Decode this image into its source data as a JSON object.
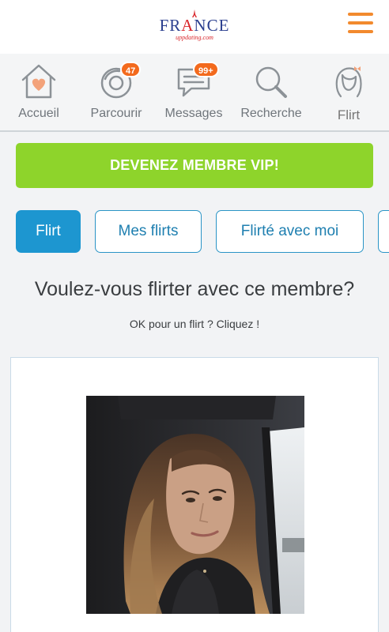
{
  "header": {
    "logo_text_before": "FR",
    "logo_text_accent": "A",
    "logo_text_after": "NCE",
    "logo_subtext": "uppdating.com",
    "menu_icon": "hamburger-icon",
    "accent_color": "#f28a2e"
  },
  "nav": {
    "items": [
      {
        "label": "Accueil",
        "icon": "home-heart-icon"
      },
      {
        "label": "Parcourir",
        "icon": "browse-icon",
        "badge": "47"
      },
      {
        "label": "Messages",
        "icon": "chat-icon",
        "badge": "99+"
      },
      {
        "label": "Recherche",
        "icon": "search-icon"
      },
      {
        "label": "Flirt",
        "icon": "flirt-icon"
      }
    ]
  },
  "vip_button": {
    "label": "DEVENEZ MEMBRE VIP!",
    "color": "#8ed42b"
  },
  "tabs": [
    {
      "label": "Flirt",
      "active": true
    },
    {
      "label": "Mes flirts",
      "active": false
    },
    {
      "label": "Flirté avec moi",
      "active": false
    }
  ],
  "flirt": {
    "question": "Voulez-vous flirter avec ce membre?",
    "subtitle": "OK pour un flirt ? Cliquez !"
  },
  "colors": {
    "primary_blue": "#1d96d0",
    "badge_orange": "#f36a1d"
  }
}
